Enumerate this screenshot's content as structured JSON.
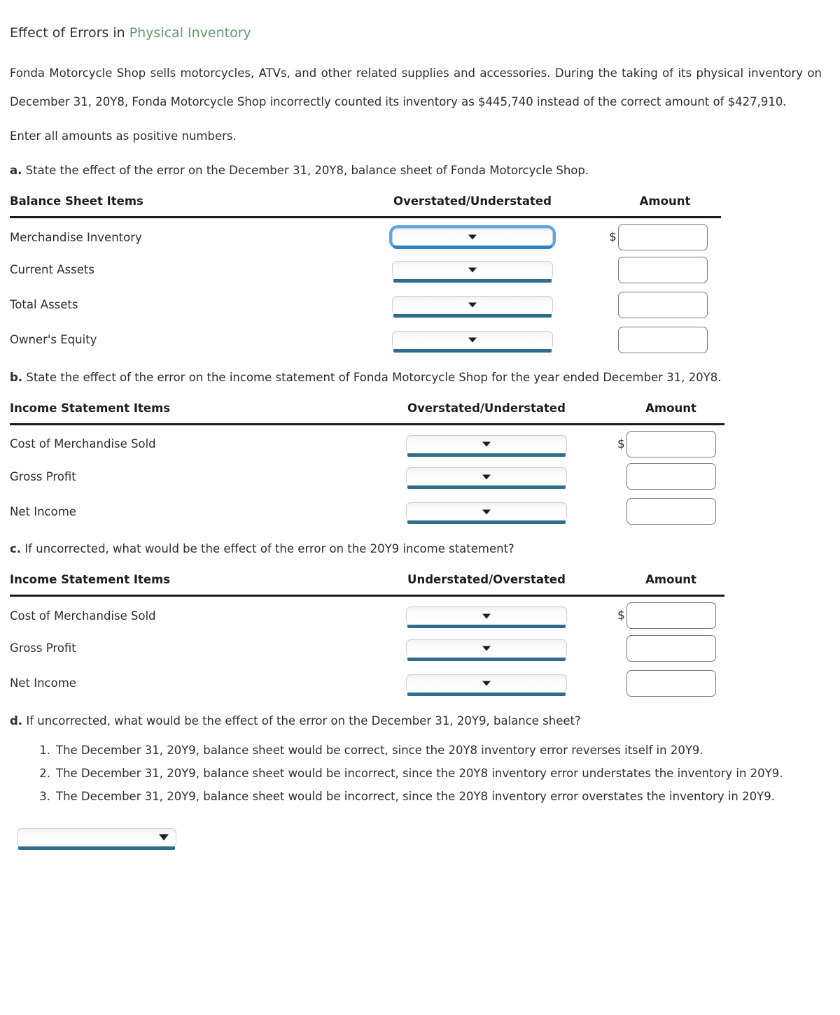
{
  "title": {
    "prefix": "Effect of Errors in ",
    "accent": "Physical Inventory",
    "accent_color": "#5f9c6e"
  },
  "intro": {
    "paragraph": "Fonda Motorcycle Shop sells motorcycles, ATVs, and other related supplies and accessories. During the taking of its physical inventory on December 31, 20Y8, Fonda Motorcycle Shop incorrectly counted its inventory as $445,740 instead of the correct amount of $427,910.",
    "instruction": "Enter all amounts as positive numbers.",
    "counted_amount": "$445,740",
    "correct_amount": "$427,910",
    "inventory_date": "December 31, 20Y8"
  },
  "parts": {
    "a": {
      "label": "a.",
      "text": "State the effect of the error on the December 31, 20Y8, balance sheet of Fonda Motorcycle Shop."
    },
    "b": {
      "label": "b.",
      "text": "State the effect of the error on the income statement of Fonda Motorcycle Shop for the year ended December 31, 20Y8."
    },
    "c": {
      "label": "c.",
      "text": "If uncorrected, what would be the effect of the error on the 20Y9 income statement?"
    },
    "d": {
      "label": "d.",
      "text": "If uncorrected, what would be the effect of the error on the December 31, 20Y9, balance sheet?",
      "options": [
        "The December 31, 20Y9, balance sheet would be correct, since the 20Y8 inventory error reverses itself in 20Y9.",
        "The December 31, 20Y9, balance sheet would be incorrect, since the 20Y8 inventory error understates the inventory in 20Y9.",
        "The December 31, 20Y9, balance sheet would be incorrect, since the 20Y8 inventory error overstates the inventory in 20Y9."
      ],
      "answer_select": {
        "value": "",
        "placeholder": ""
      }
    }
  },
  "tables": [
    {
      "id": "balance-sheet-table",
      "headers": [
        "Balance Sheet Items",
        "Overstated/Understated",
        "Amount"
      ],
      "rows": [
        {
          "item": "Merchandise Inventory",
          "effect": "",
          "amount": "",
          "show_dollar": true,
          "focused": true
        },
        {
          "item": "Current Assets",
          "effect": "",
          "amount": "",
          "show_dollar": false,
          "focused": false
        },
        {
          "item": "Total Assets",
          "effect": "",
          "amount": "",
          "show_dollar": false,
          "focused": false
        },
        {
          "item": "Owner's Equity",
          "effect": "",
          "amount": "",
          "show_dollar": false,
          "focused": false
        }
      ]
    },
    {
      "id": "income-statement-20y8-table",
      "headers": [
        "Income Statement Items",
        "Overstated/Understated",
        "Amount"
      ],
      "rows": [
        {
          "item": "Cost of Merchandise Sold",
          "effect": "",
          "amount": "",
          "show_dollar": true,
          "focused": false
        },
        {
          "item": "Gross Profit",
          "effect": "",
          "amount": "",
          "show_dollar": false,
          "focused": false
        },
        {
          "item": "Net Income",
          "effect": "",
          "amount": "",
          "show_dollar": false,
          "focused": false
        }
      ]
    },
    {
      "id": "income-statement-20y9-table",
      "headers": [
        "Income Statement Items",
        "Understated/Overstated",
        "Amount"
      ],
      "rows": [
        {
          "item": "Cost of Merchandise Sold",
          "effect": "",
          "amount": "",
          "show_dollar": true,
          "focused": false
        },
        {
          "item": "Gross Profit",
          "effect": "",
          "amount": "",
          "show_dollar": false,
          "focused": false
        },
        {
          "item": "Net Income",
          "effect": "",
          "amount": "",
          "show_dollar": false,
          "focused": false
        }
      ]
    }
  ],
  "colors": {
    "accent_green": "#5f9c6e",
    "select_underline": "#2e6d90",
    "focus_ring": "#5aa6e2",
    "rule": "#1a1a1a",
    "text": "#2d2d2d",
    "input_border": "#7a7a7a"
  },
  "icons": {
    "caret": "▼",
    "dollar": "$"
  }
}
